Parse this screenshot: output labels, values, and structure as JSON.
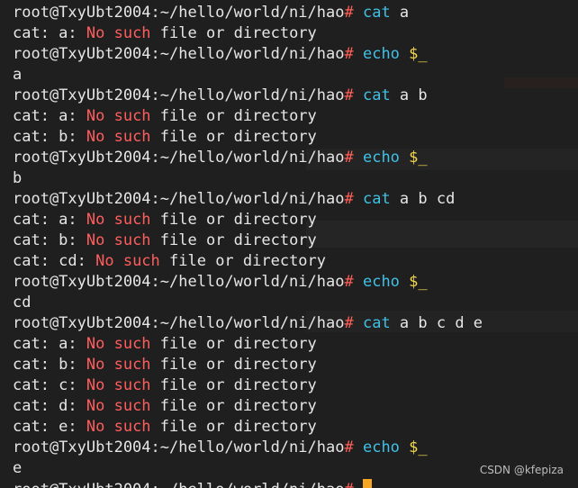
{
  "terminal": {
    "prompt": "root@TxyUbt2004:~/hello/world/ni/hao",
    "prompt_symbol": "#",
    "lines": [
      [
        {
          "t": "prompt"
        },
        {
          "t": "hash"
        },
        {
          "t": "plain",
          "v": " "
        },
        {
          "t": "cmd",
          "v": "cat"
        },
        {
          "t": "plain",
          "v": " a"
        }
      ],
      [
        {
          "t": "plain",
          "v": "cat: a: "
        },
        {
          "t": "err",
          "v": "No such"
        },
        {
          "t": "plain",
          "v": " file or directory"
        }
      ],
      [
        {
          "t": "prompt"
        },
        {
          "t": "hash"
        },
        {
          "t": "plain",
          "v": " "
        },
        {
          "t": "cmd",
          "v": "echo"
        },
        {
          "t": "plain",
          "v": " "
        },
        {
          "t": "dollar",
          "v": "$_"
        }
      ],
      [
        {
          "t": "plain",
          "v": "a"
        }
      ],
      [
        {
          "t": "prompt"
        },
        {
          "t": "hash"
        },
        {
          "t": "plain",
          "v": " "
        },
        {
          "t": "cmd",
          "v": "cat"
        },
        {
          "t": "plain",
          "v": " a b"
        }
      ],
      [
        {
          "t": "plain",
          "v": "cat: a: "
        },
        {
          "t": "err",
          "v": "No such"
        },
        {
          "t": "plain",
          "v": " file or directory"
        }
      ],
      [
        {
          "t": "plain",
          "v": "cat: b: "
        },
        {
          "t": "err",
          "v": "No such"
        },
        {
          "t": "plain",
          "v": " file or directory"
        }
      ],
      [
        {
          "t": "prompt"
        },
        {
          "t": "hash"
        },
        {
          "t": "plain",
          "v": " "
        },
        {
          "t": "cmd",
          "v": "echo"
        },
        {
          "t": "plain",
          "v": " "
        },
        {
          "t": "dollar",
          "v": "$_"
        }
      ],
      [
        {
          "t": "plain",
          "v": "b"
        }
      ],
      [
        {
          "t": "prompt"
        },
        {
          "t": "hash"
        },
        {
          "t": "plain",
          "v": " "
        },
        {
          "t": "cmd",
          "v": "cat"
        },
        {
          "t": "plain",
          "v": " a b cd"
        }
      ],
      [
        {
          "t": "plain",
          "v": "cat: a: "
        },
        {
          "t": "err",
          "v": "No such"
        },
        {
          "t": "plain",
          "v": " file or directory"
        }
      ],
      [
        {
          "t": "plain",
          "v": "cat: b: "
        },
        {
          "t": "err",
          "v": "No such"
        },
        {
          "t": "plain",
          "v": " file or directory"
        }
      ],
      [
        {
          "t": "plain",
          "v": "cat: cd: "
        },
        {
          "t": "err",
          "v": "No such"
        },
        {
          "t": "plain",
          "v": " file or directory"
        }
      ],
      [
        {
          "t": "prompt"
        },
        {
          "t": "hash"
        },
        {
          "t": "plain",
          "v": " "
        },
        {
          "t": "cmd",
          "v": "echo"
        },
        {
          "t": "plain",
          "v": " "
        },
        {
          "t": "dollar",
          "v": "$_"
        }
      ],
      [
        {
          "t": "plain",
          "v": "cd"
        }
      ],
      [
        {
          "t": "prompt"
        },
        {
          "t": "hash"
        },
        {
          "t": "plain",
          "v": " "
        },
        {
          "t": "cmd",
          "v": "cat"
        },
        {
          "t": "plain",
          "v": " a b c d e"
        }
      ],
      [
        {
          "t": "plain",
          "v": "cat: a: "
        },
        {
          "t": "err",
          "v": "No such"
        },
        {
          "t": "plain",
          "v": " file or directory"
        }
      ],
      [
        {
          "t": "plain",
          "v": "cat: b: "
        },
        {
          "t": "err",
          "v": "No such"
        },
        {
          "t": "plain",
          "v": " file or directory"
        }
      ],
      [
        {
          "t": "plain",
          "v": "cat: c: "
        },
        {
          "t": "err",
          "v": "No such"
        },
        {
          "t": "plain",
          "v": " file or directory"
        }
      ],
      [
        {
          "t": "plain",
          "v": "cat: d: "
        },
        {
          "t": "err",
          "v": "No such"
        },
        {
          "t": "plain",
          "v": " file or directory"
        }
      ],
      [
        {
          "t": "plain",
          "v": "cat: e: "
        },
        {
          "t": "err",
          "v": "No such"
        },
        {
          "t": "plain",
          "v": " file or directory"
        }
      ],
      [
        {
          "t": "prompt"
        },
        {
          "t": "hash"
        },
        {
          "t": "plain",
          "v": " "
        },
        {
          "t": "cmd",
          "v": "echo"
        },
        {
          "t": "plain",
          "v": " "
        },
        {
          "t": "dollar",
          "v": "$_"
        }
      ],
      [
        {
          "t": "plain",
          "v": "e"
        }
      ],
      [
        {
          "t": "prompt"
        },
        {
          "t": "hash"
        },
        {
          "t": "plain",
          "v": " "
        },
        {
          "t": "cursor"
        }
      ]
    ]
  },
  "watermark": "CSDN @kfepiza",
  "colors": {
    "background": "#1f1f1f",
    "text": "#e6e6e6",
    "prompt_hash": "#ff5f56",
    "command": "#3fc1e6",
    "variable": "#f5d84a",
    "error": "#ff5d5d",
    "cursor": "#f5a623"
  }
}
